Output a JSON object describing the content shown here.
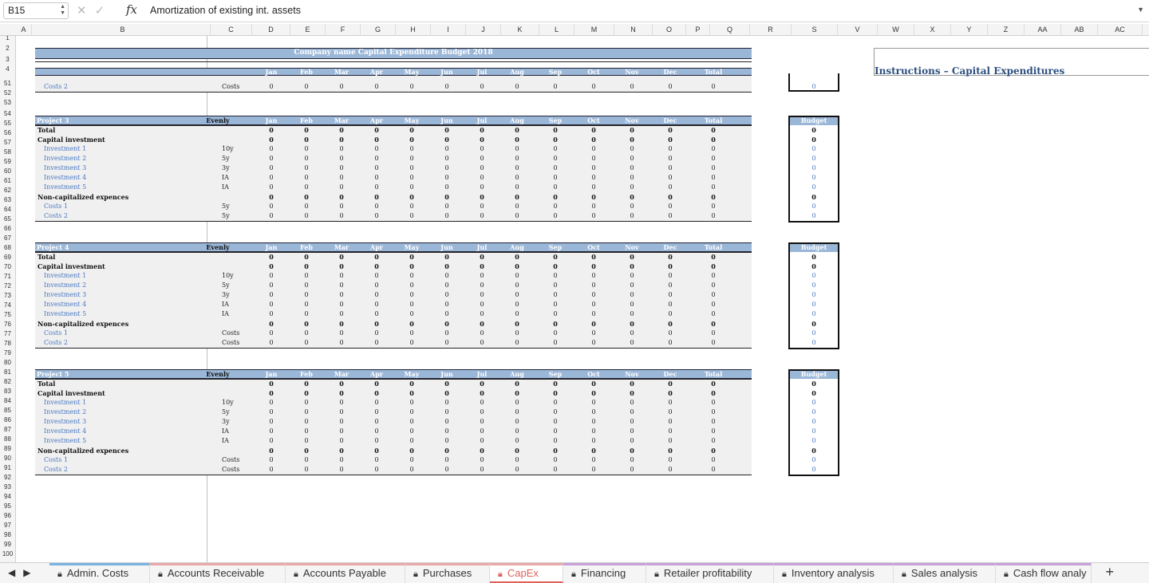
{
  "namebox": "B15",
  "formula_bar": {
    "fx": "fx",
    "content": "Amortization of existing int. assets"
  },
  "columns": [
    "A",
    "B",
    "C",
    "D",
    "E",
    "F",
    "G",
    "H",
    "I",
    "J",
    "K",
    "L",
    "M",
    "N",
    "O",
    "P",
    "Q",
    "R",
    "S",
    "V",
    "W",
    "X",
    "Y",
    "Z",
    "AA",
    "AB",
    "AC"
  ],
  "title": "Company name Capital Expenditure Budget 2018",
  "instructions_title": "Instructions – Capital Expenditures",
  "months": [
    "Jan",
    "Feb",
    "Mar",
    "Apr",
    "May",
    "Jun",
    "Jul",
    "Aug",
    "Sep",
    "Oct",
    "Nov",
    "Dec"
  ],
  "total_label": "Total",
  "budget_label": "Budget",
  "evenly_label": "Evenly",
  "top_rows": {
    "costs2_label": "Costs 2",
    "costs2_type": "Costs"
  },
  "projects": [
    {
      "name": "Project 3",
      "types": [
        "10y",
        "5y",
        "3y",
        "IA",
        "IA",
        "5y",
        "5y"
      ]
    },
    {
      "name": "Project 4",
      "types": [
        "10y",
        "5y",
        "3y",
        "IA",
        "IA",
        "Costs",
        "Costs"
      ]
    },
    {
      "name": "Project 5",
      "types": [
        "10y",
        "5y",
        "3y",
        "IA",
        "IA",
        "Costs",
        "Costs"
      ]
    }
  ],
  "row_labels": {
    "total": "Total",
    "capital": "Capital investment",
    "investments": [
      "Investment 1",
      "Investment 2",
      "Investment 3",
      "Investment 4",
      "Investment 5"
    ],
    "noncap": "Non-capitalized expences",
    "costs": [
      "Costs 1",
      "Costs 2"
    ]
  },
  "zero": "0",
  "tabs": [
    "Admin. Costs",
    "Accounts Receivable",
    "Accounts Payable",
    "Purchases",
    "CapEx",
    "Financing",
    "Retailer profitability",
    "Inventory analysis",
    "Sales analysis",
    "Cash flow analy"
  ],
  "active_tab": "CapEx",
  "plus": "+"
}
